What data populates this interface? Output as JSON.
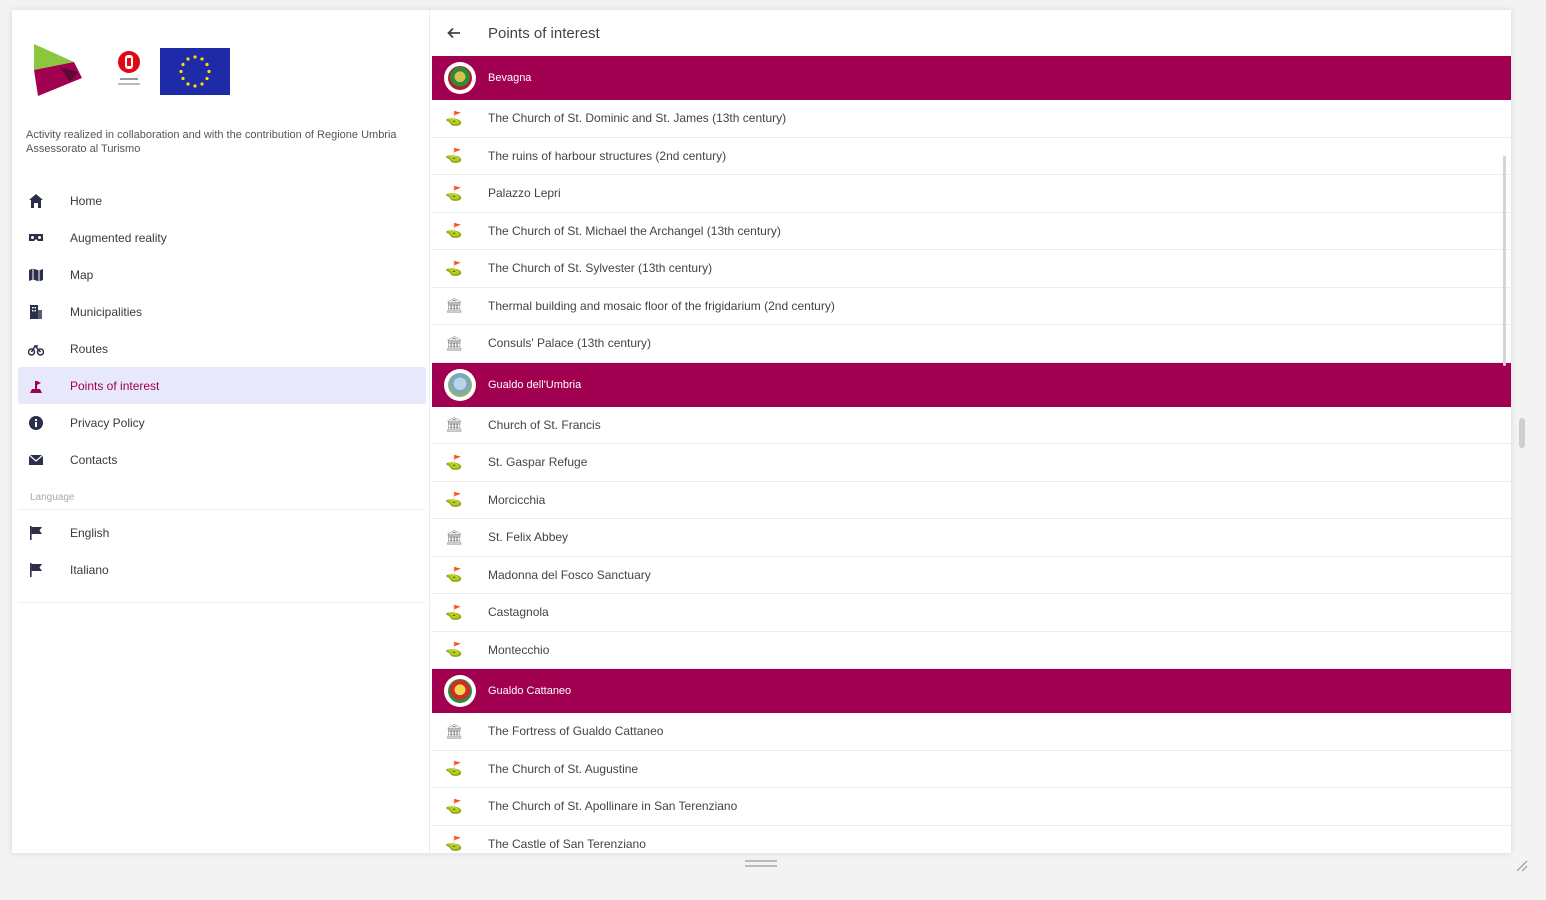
{
  "sidebar": {
    "tagline": "Activity realized in collaboration and with the contribution of Regione Umbria Assessorato al Turismo",
    "nav": [
      {
        "label": "Home",
        "icon": "home-icon"
      },
      {
        "label": "Augmented reality",
        "icon": "vr-glasses-icon"
      },
      {
        "label": "Map",
        "icon": "map-icon"
      },
      {
        "label": "Municipalities",
        "icon": "building-icon"
      },
      {
        "label": "Routes",
        "icon": "bicycle-icon"
      },
      {
        "label": "Points of interest",
        "icon": "landmark-icon",
        "active": true
      },
      {
        "label": "Privacy Policy",
        "icon": "info-icon"
      },
      {
        "label": "Contacts",
        "icon": "envelope-icon"
      }
    ],
    "language_header": "Language",
    "languages": [
      {
        "label": "English",
        "icon": "flag-icon"
      },
      {
        "label": "Italiano",
        "icon": "flag-icon"
      }
    ]
  },
  "header": {
    "title": "Points of interest"
  },
  "groups": [
    {
      "name": "Bevagna",
      "items": [
        {
          "label": "The Church of St. Dominic and St. James (13th century)",
          "icon": "monument-icon"
        },
        {
          "label": "The ruins of harbour structures (2nd century)",
          "icon": "monument-icon"
        },
        {
          "label": "Palazzo Lepri",
          "icon": "monument-icon"
        },
        {
          "label": "The Church of St. Michael the Archangel (13th century)",
          "icon": "monument-icon"
        },
        {
          "label": "The Church of St. Sylvester (13th century)",
          "icon": "monument-icon"
        },
        {
          "label": "Thermal building and mosaic floor of the frigidarium (2nd century)",
          "icon": "museum-icon"
        },
        {
          "label": "Consuls' Palace (13th century)",
          "icon": "museum-icon"
        }
      ]
    },
    {
      "name": "Gualdo dell'Umbria",
      "items": [
        {
          "label": "Church of St. Francis",
          "icon": "museum-icon"
        },
        {
          "label": "St. Gaspar Refuge",
          "icon": "monument-icon"
        },
        {
          "label": "Morcicchia",
          "icon": "monument-icon"
        },
        {
          "label": "St. Felix Abbey",
          "icon": "museum-icon"
        },
        {
          "label": "Madonna del Fosco Sanctuary",
          "icon": "monument-icon"
        },
        {
          "label": "Castagnola",
          "icon": "monument-icon"
        },
        {
          "label": "Montecchio",
          "icon": "monument-icon"
        }
      ]
    },
    {
      "name": "Gualdo Cattaneo",
      "items": [
        {
          "label": "The Fortress of Gualdo Cattaneo",
          "icon": "museum-icon"
        },
        {
          "label": "The Church of St. Augustine",
          "icon": "monument-icon"
        },
        {
          "label": "The Church of St. Apollinare in San Terenziano",
          "icon": "monument-icon"
        },
        {
          "label": "The Castle of San Terenziano",
          "icon": "monument-icon"
        }
      ]
    }
  ]
}
